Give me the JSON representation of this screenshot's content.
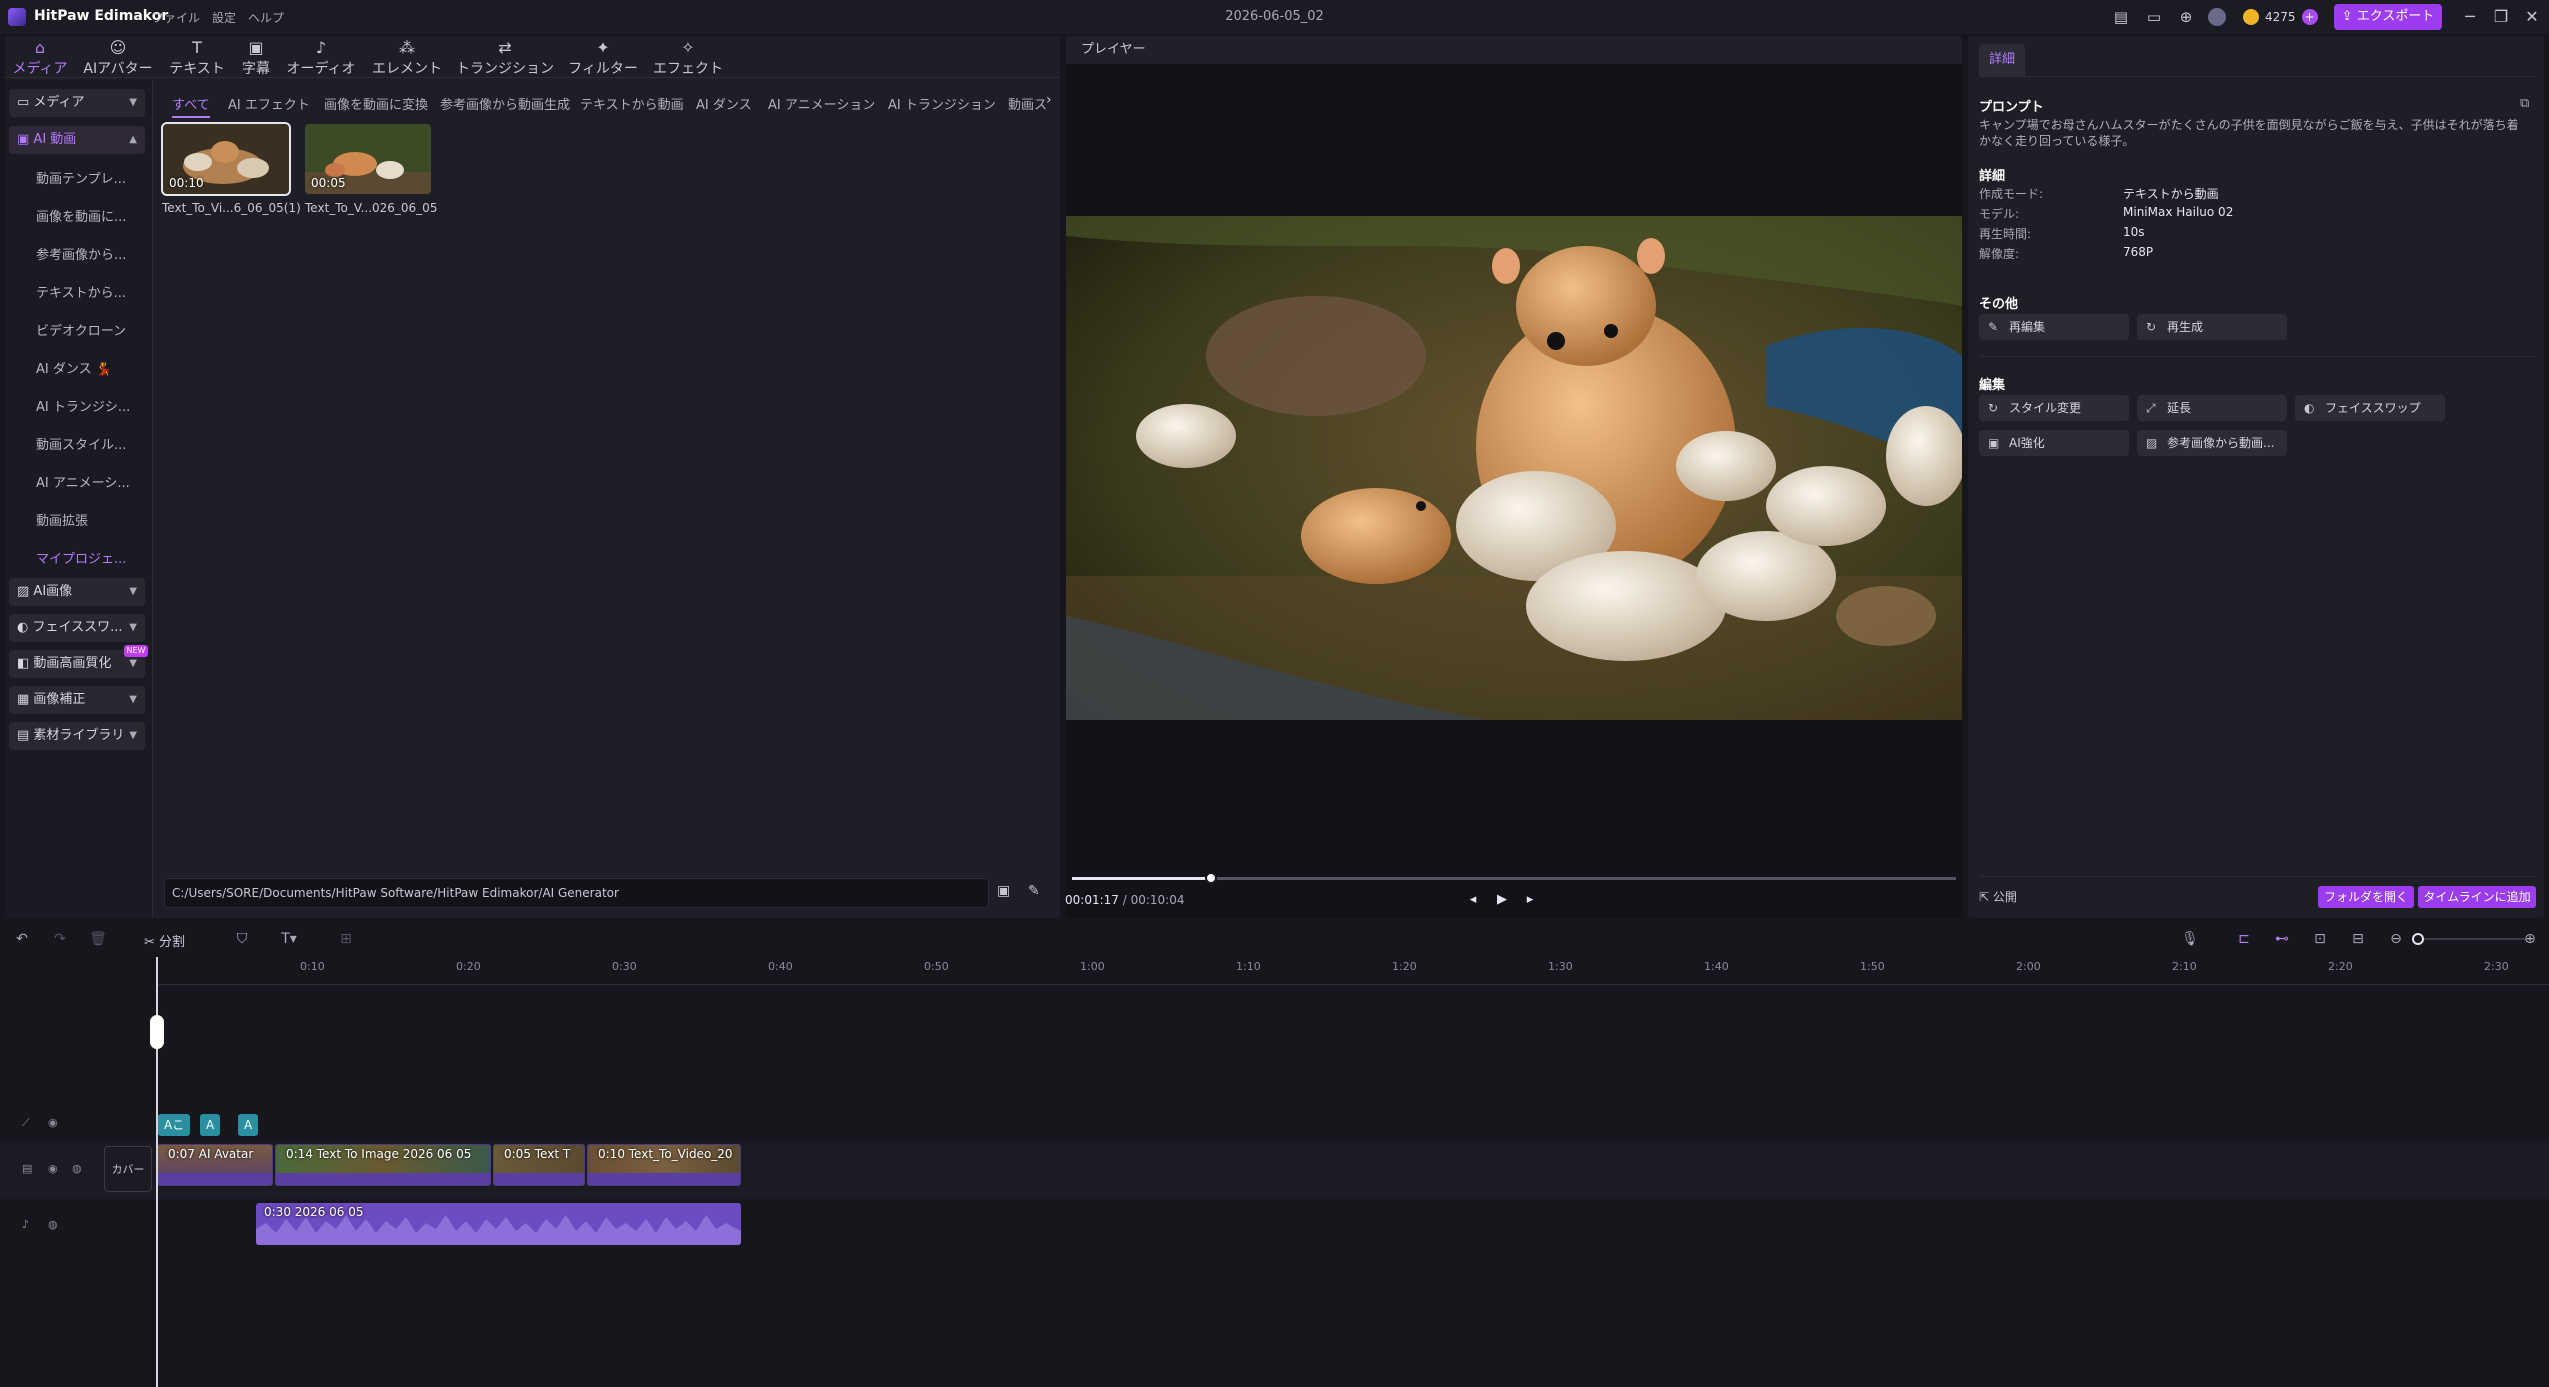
{
  "app": {
    "name": "HitPaw Edimakor",
    "document_title": "2026-06-05_02"
  },
  "menu": [
    "ファイル",
    "設定",
    "ヘルプ"
  ],
  "header": {
    "credits": "4275",
    "export_label": "エクスポート"
  },
  "top_tabs": [
    {
      "label": "メディア",
      "icon": "media-icon"
    },
    {
      "label": "AIアバター",
      "icon": "avatar-icon"
    },
    {
      "label": "テキスト",
      "icon": "text-icon"
    },
    {
      "label": "字幕",
      "icon": "subtitle-icon"
    },
    {
      "label": "オーディオ",
      "icon": "audio-icon"
    },
    {
      "label": "エレメント",
      "icon": "element-icon"
    },
    {
      "label": "トランジション",
      "icon": "transition-icon"
    },
    {
      "label": "フィルター",
      "icon": "filter-icon"
    },
    {
      "label": "エフェクト",
      "icon": "effect-icon"
    }
  ],
  "sidebar": {
    "groups": [
      {
        "label": "メディア"
      },
      {
        "label": "AI 動画"
      },
      {
        "label": "AI画像"
      },
      {
        "label": "フェイススワ..."
      },
      {
        "label": "動画高画質化",
        "badge": "NEW"
      },
      {
        "label": "画像補正"
      },
      {
        "label": "素材ライブラリ"
      }
    ],
    "ai_video_items": [
      "動画テンプレ...",
      "画像を動画に...",
      "参考画像から...",
      "テキストから...",
      "ビデオクローン",
      "AI ダンス 💃",
      "AI トランジシ...",
      "動画スタイル...",
      "AI アニメーシ...",
      "動画拡張",
      "マイプロジェ..."
    ]
  },
  "filter_tabs": [
    "すべて",
    "AI エフェクト",
    "画像を動画に変換",
    "参考画像から動画生成",
    "テキストから動画",
    "AI ダンス",
    "AI アニメーション",
    "AI トランジション",
    "動画ス"
  ],
  "media_items": [
    {
      "name": "Text_To_Vi...6_06_05(1)",
      "duration": "00:10"
    },
    {
      "name": "Text_To_V...026_06_05",
      "duration": "00:05"
    }
  ],
  "path": "C:/Users/SORE/Documents/HitPaw Software/HitPaw Edimakor/AI Generator",
  "player": {
    "title": "プレイヤー",
    "current": "00:01:17",
    "separator": " / ",
    "total": "00:10:04",
    "progress": 0.13
  },
  "details": {
    "tab": "詳細",
    "prompt_title": "プロンプト",
    "prompt_text": "キャンプ場でお母さんハムスターがたくさんの子供を面倒見ながらご飯を与え、子供はそれが落ち着かなく走り回っている様子。",
    "info_title": "詳細",
    "info": [
      {
        "key": "作成モード:",
        "value": "テキストから動画"
      },
      {
        "key": "モデル:",
        "value": "MiniMax Hailuo 02"
      },
      {
        "key": "再生時間:",
        "value": "10s"
      },
      {
        "key": "解像度:",
        "value": "768P"
      }
    ],
    "other_title": "その他",
    "other_buttons": [
      "再編集",
      "再生成"
    ],
    "edit_title": "編集",
    "edit_buttons": [
      "スタイル変更",
      "延長",
      "フェイススワップ",
      "AI強化",
      "参考画像から動画..."
    ],
    "publish": "公開",
    "open_folder": "フォルダを開く",
    "add_timeline": "タイムラインに追加"
  },
  "timeline": {
    "split_label": "分割",
    "ticks": [
      "0:10",
      "0:20",
      "0:30",
      "0:40",
      "0:50",
      "1:00",
      "1:10",
      "1:20",
      "1:30",
      "1:40",
      "1:50",
      "2:00",
      "2:10",
      "2:20",
      "2:30"
    ],
    "cover_label": "カバー",
    "subtitle_chips": [
      "Aこ",
      "A",
      "A"
    ],
    "clips": [
      {
        "label": "0:07 AI Avatar"
      },
      {
        "label": "0:14 Text To Image 2026 06 05"
      },
      {
        "label": "0:05 Text T"
      },
      {
        "label": "0:10 Text_To_Video_20"
      }
    ],
    "audio_label": "0:30 2026 06 05"
  },
  "colors": {
    "accent": "#b47cf7",
    "export": "#9b3cf0",
    "subtitle": "#2a8fa0"
  }
}
